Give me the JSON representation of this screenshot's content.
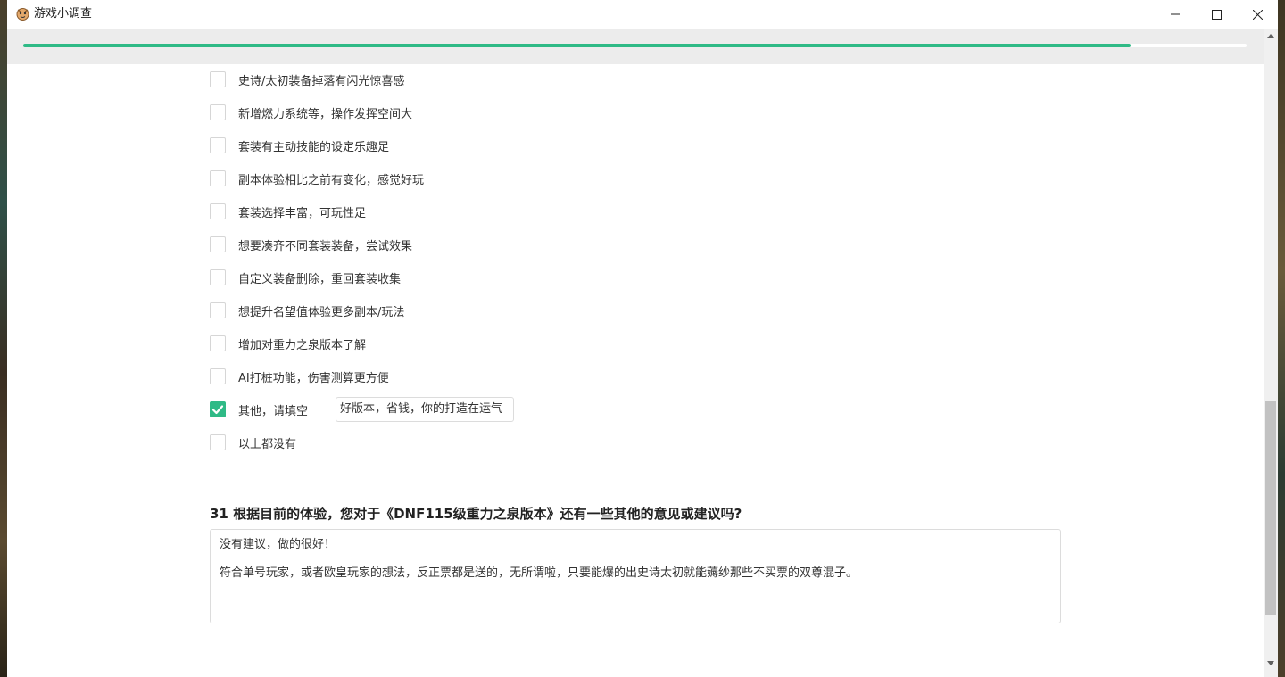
{
  "window": {
    "title": "游戏小调查",
    "icon": "mascot-icon"
  },
  "progress": {
    "fraction": 0.905
  },
  "options": [
    {
      "label": "史诗/太初装备掉落有闪光惊喜感",
      "checked": false
    },
    {
      "label": "新增燃力系统等，操作发挥空间大",
      "checked": false
    },
    {
      "label": "套装有主动技能的设定乐趣足",
      "checked": false
    },
    {
      "label": "副本体验相比之前有变化，感觉好玩",
      "checked": false
    },
    {
      "label": "套装选择丰富，可玩性足",
      "checked": false
    },
    {
      "label": "想要凑齐不同套装装备，尝试效果",
      "checked": false
    },
    {
      "label": "自定义装备删除，重回套装收集",
      "checked": false
    },
    {
      "label": "想提升名望值体验更多副本/玩法",
      "checked": false
    },
    {
      "label": "增加对重力之泉版本了解",
      "checked": false
    },
    {
      "label": "AI打桩功能，伤害测算更方便",
      "checked": false
    },
    {
      "label": "其他，请填空",
      "checked": true
    },
    {
      "label": "以上都没有",
      "checked": false
    }
  ],
  "other_input": {
    "value": "好版本，省钱，你的打造在运气"
  },
  "question31": {
    "title": "31 根据目前的体验，您对于《DNF115级重力之泉版本》还有一些其他的意见或建议吗?",
    "answer_line1": "没有建议，做的很好！",
    "answer_line2": "符合单号玩家，或者欧皇玩家的想法，反正票都是送的，无所谓啦，只要能爆的出史诗太初就能薅纱那些不买票的双尊混子。"
  },
  "colors": {
    "accent": "#2fba86",
    "progress_track": "#ffffff",
    "header_bg": "#ececec"
  }
}
